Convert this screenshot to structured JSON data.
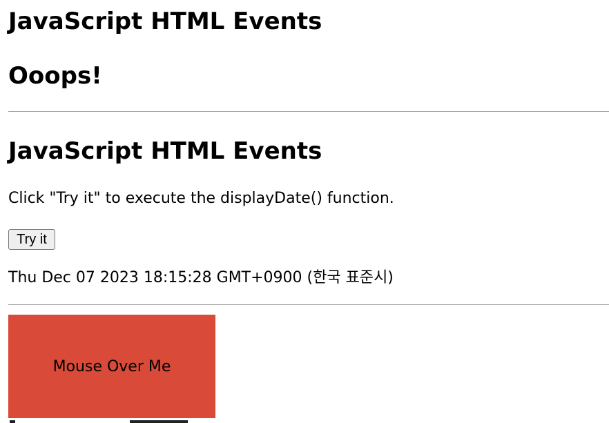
{
  "section1": {
    "title": "JavaScript HTML Events",
    "message": "Ooops!"
  },
  "section2": {
    "title": "JavaScript HTML Events",
    "instructions": "Click \"Try it\" to execute the displayDate() function.",
    "try_button_label": "Try it",
    "date_output": "Thu Dec 07 2023 18:15:28 GMT+0900 (한국 표준시)"
  },
  "section3": {
    "hover_box_label": "Mouse Over Me",
    "hover_box_color": "#d94a38"
  }
}
